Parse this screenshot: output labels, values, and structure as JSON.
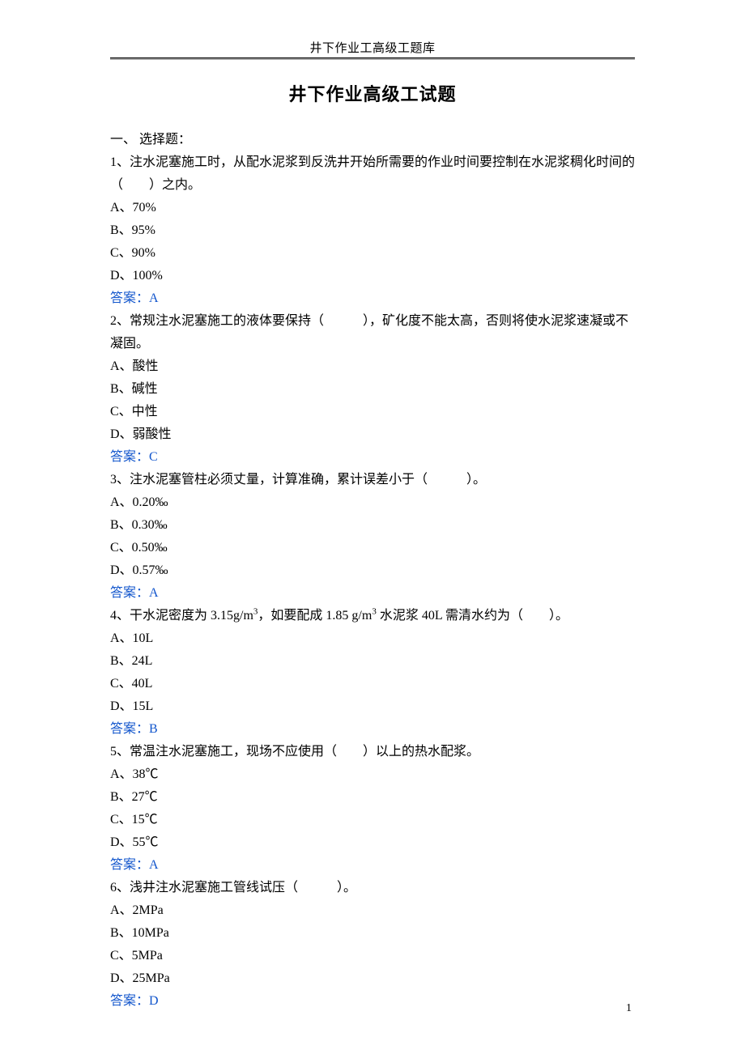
{
  "header": "井下作业工高级工题库",
  "title": "井下作业高级工试题",
  "section_header": "一、 选择题：",
  "questions": [
    {
      "stem": "1、注水泥塞施工时，从配水泥浆到反洗井开始所需要的作业时间要控制在水泥浆稠化时间的（　　）之内。",
      "options": [
        "A、70%",
        "B、95%",
        "C、90%",
        "D、100%"
      ],
      "answer": "答案：A"
    },
    {
      "stem": "2、常规注水泥塞施工的液体要保持（　　　），矿化度不能太高，否则将使水泥浆速凝或不凝固。",
      "options": [
        "A、酸性",
        "B、碱性",
        "C、中性",
        "D、弱酸性"
      ],
      "answer": "答案：C"
    },
    {
      "stem": "3、注水泥塞管柱必须丈量，计算准确，累计误差小于（　　　）。",
      "options": [
        "A、0.20‰",
        "B、0.30‰",
        "C、0.50‰",
        "D、0.57‰"
      ],
      "answer": "答案：A"
    },
    {
      "stem_html": "4、干水泥密度为 3.15g/m<sup>3</sup>，如要配成 1.85 g/m<sup>3</sup> 水泥浆 40L 需清水约为（　　）。",
      "options": [
        "A、10L",
        "B、24L",
        "C、40L",
        "D、15L"
      ],
      "answer": "答案：B"
    },
    {
      "stem": "5、常温注水泥塞施工，现场不应使用（　　）以上的热水配浆。",
      "options": [
        "A、38℃",
        "B、27℃",
        "C、15℃",
        "D、55℃"
      ],
      "answer": "答案：A"
    },
    {
      "stem": "6、浅井注水泥塞施工管线试压（　　　）。",
      "options": [
        "A、2MPa",
        "B、10MPa",
        "C、5MPa",
        "D、25MPa"
      ],
      "answer": "答案：D"
    }
  ],
  "page_number": "1"
}
